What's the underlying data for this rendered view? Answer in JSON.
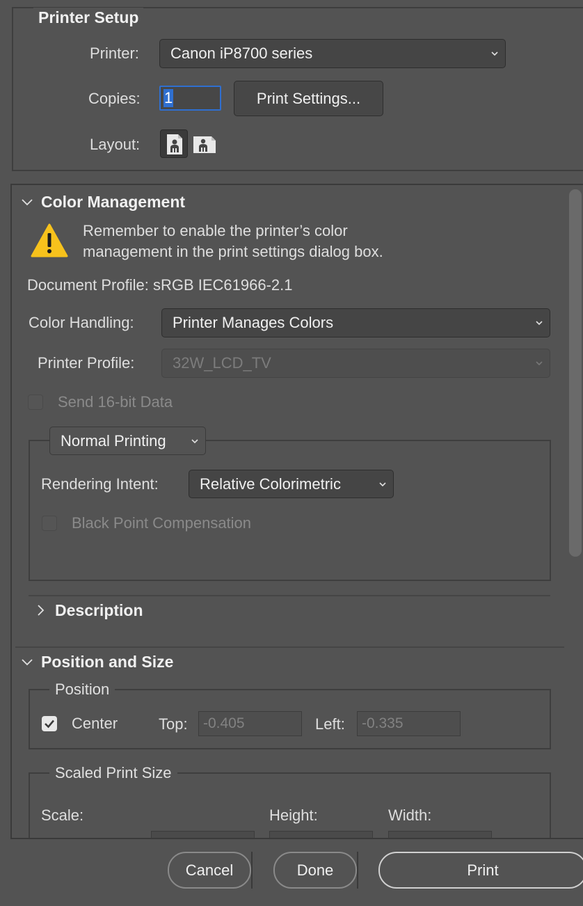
{
  "printer_setup": {
    "title": "Printer Setup",
    "printer_label": "Printer:",
    "printer_value": "Canon iP8700 series",
    "copies_label": "Copies:",
    "copies_value": "1",
    "print_settings_button": "Print Settings...",
    "layout_label": "Layout:"
  },
  "color_management": {
    "title": "Color Management",
    "warning_line1": "Remember to enable the printer’s color",
    "warning_line2": "management in the print settings dialog box.",
    "document_profile": "Document Profile: sRGB IEC61966-2.1",
    "color_handling_label": "Color Handling:",
    "color_handling_value": "Printer Manages Colors",
    "printer_profile_label": "Printer Profile:",
    "printer_profile_value": "32W_LCD_TV",
    "send_16bit_label": "Send 16-bit Data",
    "normal_printing_value": "Normal Printing",
    "rendering_intent_label": "Rendering Intent:",
    "rendering_intent_value": "Relative Colorimetric",
    "black_point_label": "Black Point Compensation"
  },
  "description": {
    "title": "Description"
  },
  "position_and_size": {
    "title": "Position and Size",
    "position_legend": "Position",
    "center_label": "Center",
    "center_checked": true,
    "top_label": "Top:",
    "top_value": "-0.405",
    "left_label": "Left:",
    "left_value": "-0.335",
    "scaled_legend": "Scaled Print Size",
    "scale_label": "Scale:",
    "height_label": "Height:",
    "width_label": "Width:"
  },
  "footer": {
    "cancel_label": "Cancel",
    "done_label": "Done",
    "print_label": "Print"
  }
}
